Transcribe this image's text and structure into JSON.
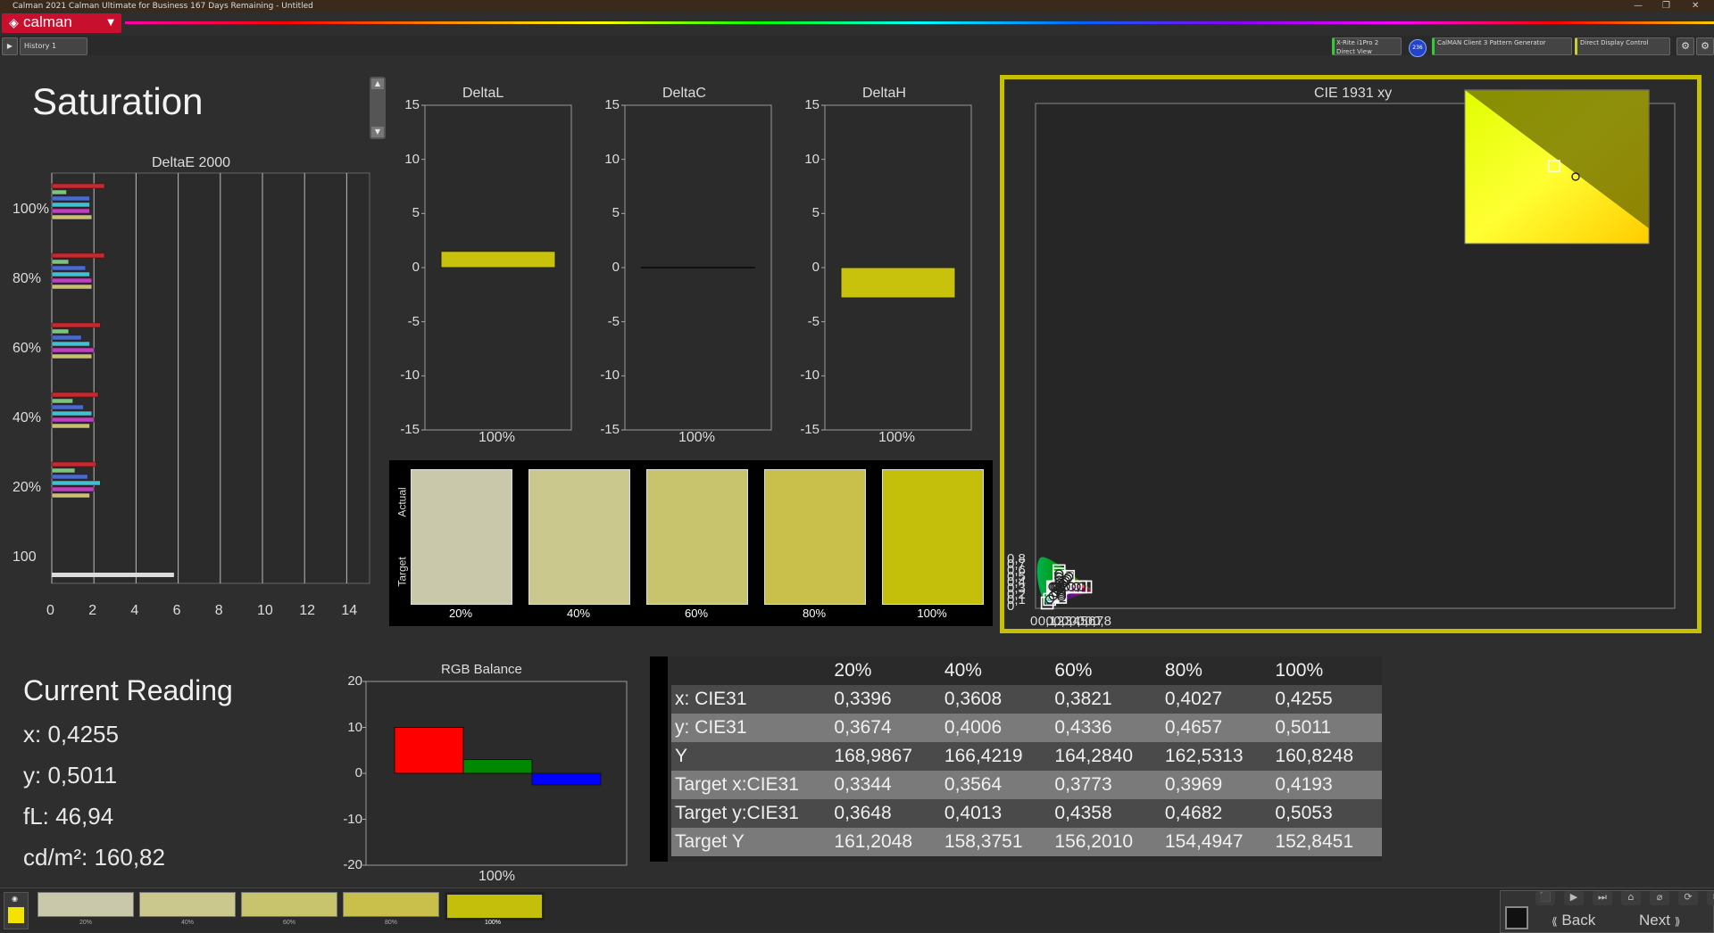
{
  "window": {
    "title": "Calman 2021 Calman Ultimate for Business 167 Days Remaining  - Untitled"
  },
  "app": {
    "logo_text": "calman",
    "tab_label": "History 1"
  },
  "devices": {
    "meter": "X-Rite i1Pro 2",
    "meter_sub": "Direct View",
    "meter_badge": "236",
    "pattern_gen": "CalMAN Client 3 Pattern Generator",
    "display_ctrl": "Direct Display Control"
  },
  "page": {
    "title": "Saturation"
  },
  "deltae": {
    "title": "DeltaE 2000",
    "y_labels": [
      "100%",
      "80%",
      "60%",
      "40%",
      "20%",
      "100"
    ],
    "x_labels": [
      "0",
      "2",
      "4",
      "6",
      "8",
      "10",
      "12",
      "14"
    ]
  },
  "delta_charts": {
    "ticks": [
      "15",
      "10",
      "5",
      "0",
      "-5",
      "-10",
      "-15"
    ],
    "deltaL": {
      "title": "DeltaL",
      "xlabel": "100%",
      "value": 1.5
    },
    "deltaC": {
      "title": "DeltaC",
      "xlabel": "100%",
      "value": 0
    },
    "deltaH": {
      "title": "DeltaH",
      "xlabel": "100%",
      "value": -2.8
    }
  },
  "swatches": {
    "actual_label": "Actual",
    "target_label": "Target",
    "labels": [
      "20%",
      "40%",
      "60%",
      "80%",
      "100%"
    ],
    "colors": [
      "#c9c8ab",
      "#cbc88e",
      "#c8c46d",
      "#c8c04a",
      "#c4bf0a"
    ]
  },
  "cie": {
    "title": "CIE 1931 xy",
    "y_labels": [
      "0,8",
      "0,7",
      "0,6",
      "0,5",
      "0,4",
      "0,3",
      "0,2",
      "0,1",
      "0"
    ],
    "x_labels": [
      "0",
      "0,1",
      "0,2",
      "0,3",
      "0,4",
      "0,5",
      "0,6",
      "0,7",
      "0,8"
    ]
  },
  "current": {
    "title": "Current Reading",
    "x": "x: 0,4255",
    "y": "y: 0,5011",
    "fl": "fL: 46,94",
    "cd": "cd/m²: 160,82"
  },
  "rgb": {
    "title": "RGB Balance",
    "ticks": [
      "20",
      "10",
      "0",
      "-10",
      "-20"
    ],
    "xlabel": "100%",
    "values": [
      10,
      3,
      -2.5
    ],
    "colors": [
      "#ff0000",
      "#008800",
      "#0000ff"
    ]
  },
  "table": {
    "headers": [
      "",
      "20%",
      "40%",
      "60%",
      "80%",
      "100%"
    ],
    "rows": [
      [
        "x: CIE31",
        "0,3396",
        "0,3608",
        "0,3821",
        "0,4027",
        "0,4255"
      ],
      [
        "y: CIE31",
        "0,3674",
        "0,4006",
        "0,4336",
        "0,4657",
        "0,5011"
      ],
      [
        "Y",
        "168,9867",
        "166,4219",
        "164,2840",
        "162,5313",
        "160,8248"
      ],
      [
        "Target x:CIE31",
        "0,3344",
        "0,3564",
        "0,3773",
        "0,3969",
        "0,4193"
      ],
      [
        "Target y:CIE31",
        "0,3648",
        "0,4013",
        "0,4358",
        "0,4682",
        "0,5053"
      ],
      [
        "Target Y",
        "161,2048",
        "158,3751",
        "156,2010",
        "154,4947",
        "152,8451"
      ]
    ]
  },
  "bottom": {
    "swatch_labels": [
      "20%",
      "40%",
      "60%",
      "80%",
      "100%"
    ],
    "swatch_colors": [
      "#c9c8ab",
      "#cbc88e",
      "#c8c46d",
      "#c8c04a",
      "#c4bf0a"
    ],
    "back": "Back",
    "next": "Next"
  },
  "accent": "#c6c000"
}
